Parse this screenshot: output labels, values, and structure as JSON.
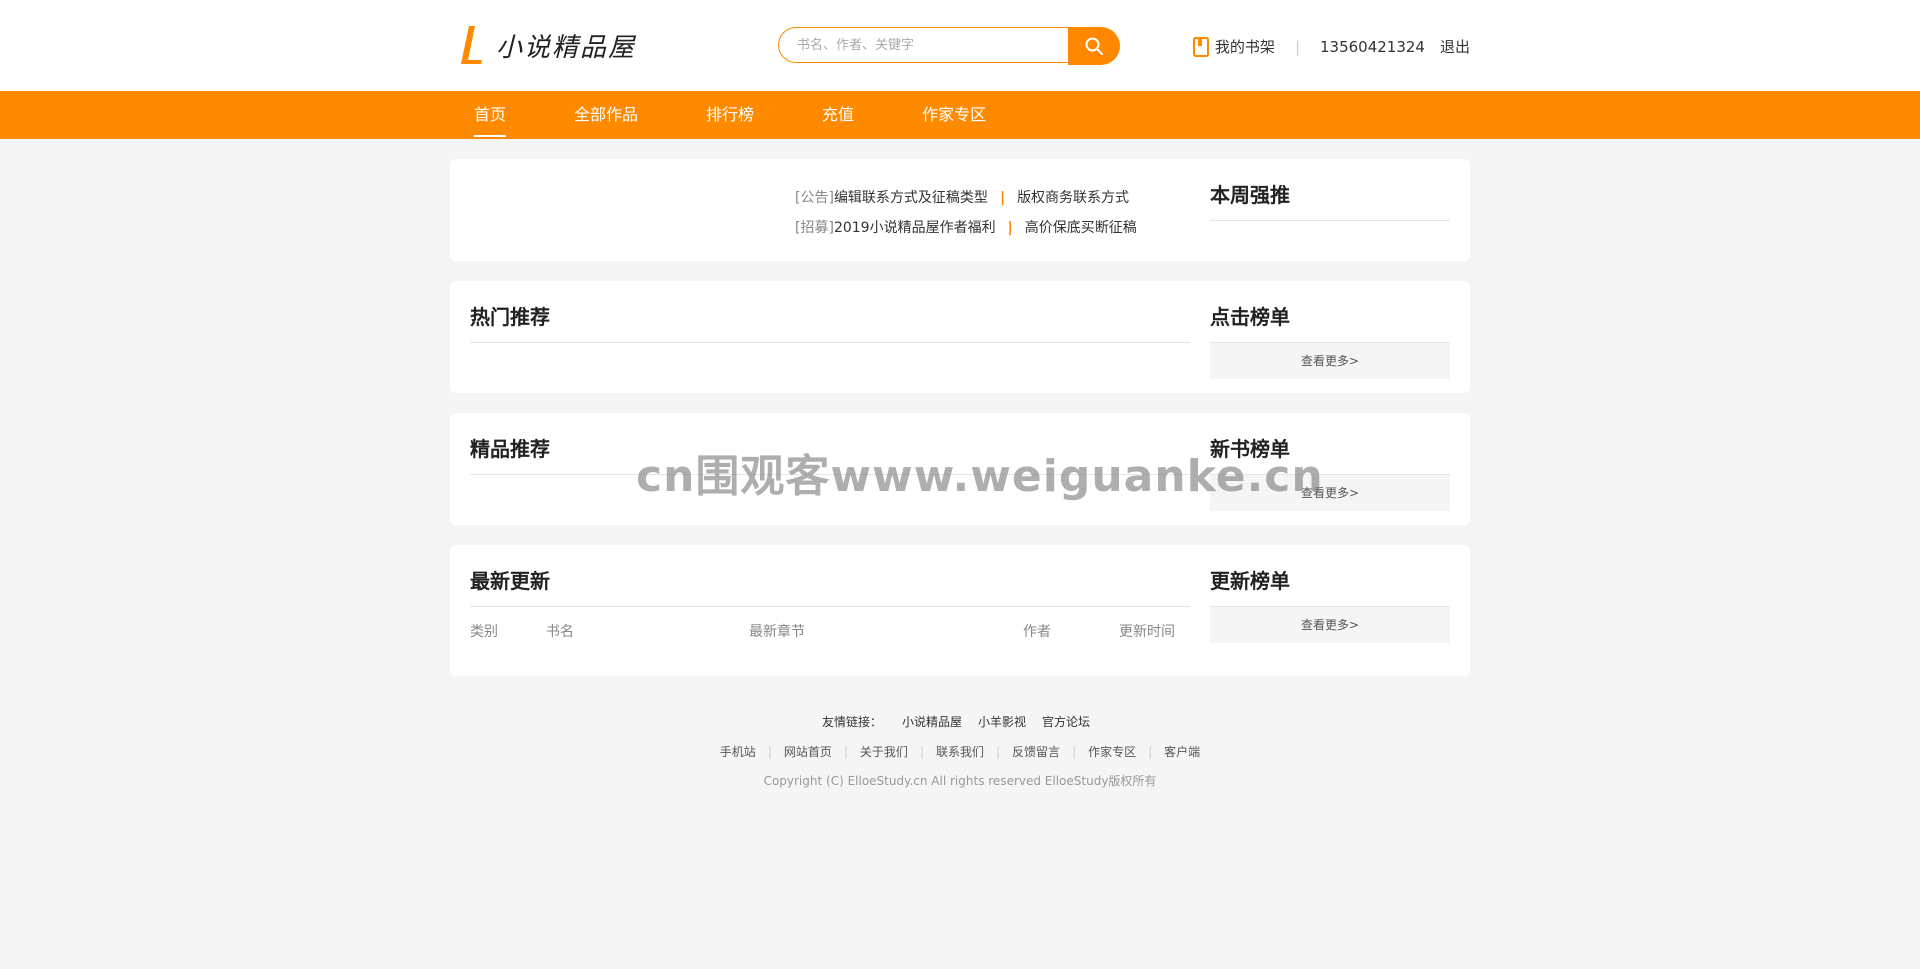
{
  "header": {
    "logo_text": "小说精品屋",
    "search_placeholder": "书名、作者、关键字",
    "bookshelf_label": "我的书架",
    "separator": "|",
    "phone": "13560421324",
    "logout_label": "退出"
  },
  "nav": {
    "items": [
      "首页",
      "全部作品",
      "排行榜",
      "充值",
      "作家专区"
    ],
    "active_index": 0
  },
  "notice": {
    "line1": {
      "tag": "[公告]",
      "a": "编辑联系方式及征稿类型",
      "sep": "|",
      "b": "版权商务联系方式"
    },
    "line2": {
      "tag": "[招募]",
      "a": "2019小说精品屋作者福利",
      "sep": "|",
      "b": "高价保底买断征稿"
    }
  },
  "sections": {
    "weekly": "本周强推",
    "hot": "热门推荐",
    "click_rank": "点击榜单",
    "quality": "精品推荐",
    "new_rank": "新书榜单",
    "latest": "最新更新",
    "update_rank": "更新榜单",
    "more_label": "查看更多>"
  },
  "latest_table": {
    "columns": [
      "类别",
      "书名",
      "最新章节",
      "作者",
      "更新时间"
    ]
  },
  "footer": {
    "friend_label": "友情链接：",
    "friends": [
      "小说精品屋",
      "小羊影视",
      "官方论坛"
    ],
    "links": [
      "手机站",
      "网站首页",
      "关于我们",
      "联系我们",
      "反馈留言",
      "作家专区",
      "客户端"
    ],
    "link_sep": "|",
    "copyright": "Copyright (C) ElloeStudy.cn All rights reserved  ElloeStudy版权所有"
  },
  "watermark": "cn围观客www.weiguanke.cn",
  "colors": {
    "accent": "#ff8a00",
    "background": "#f5f5f5"
  }
}
